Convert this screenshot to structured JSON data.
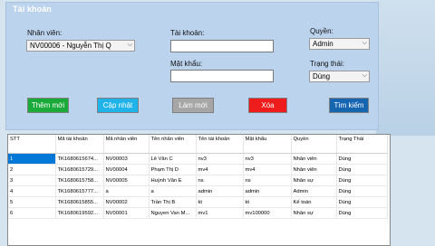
{
  "group_title": "Tài khoản",
  "labels": {
    "employee": "Nhân viên:",
    "account": "Tài khoản:",
    "password": "Mật khẩu:",
    "role": "Quyền:",
    "status": "Trạng thái:"
  },
  "fields": {
    "employee_value": "NV00006 - Nguyễn Thị Q",
    "account_value": "",
    "password_value": "",
    "role_value": "Admin",
    "status_value": "Dùng"
  },
  "buttons": {
    "add": "Thêm mới",
    "update": "Cập nhật",
    "refresh": "Làm mới",
    "delete": "Xóa",
    "search": "Tìm kiếm"
  },
  "colors": {
    "add": "#1aaa3a",
    "update": "#1fb3ea",
    "refresh": "#a6a6a6",
    "delete": "#ef1c1c",
    "search": "#1565b0"
  },
  "table": {
    "headers": [
      "STT",
      "Mã tài khoản",
      "Mã nhân viên",
      "Tên nhân viên",
      "Tên tài khoản",
      "Mật khẩu",
      "Quyền",
      "Trạng Thái"
    ],
    "rows": [
      [
        "1",
        "TK1680615674...",
        "NV00003",
        "Lê Văn C",
        "nv3",
        "nv3",
        "Nhân viên",
        "Dùng"
      ],
      [
        "2",
        "TK1680615729...",
        "NV00004",
        "Phạm Thị D",
        "mv4",
        "mv4",
        "Nhân viên",
        "Dùng"
      ],
      [
        "3",
        "TK1680615758...",
        "NV00005",
        "Huỳnh Văn E",
        "ns",
        "ns",
        "Nhân sự",
        "Dùng"
      ],
      [
        "4",
        "TK1680615777...",
        "a",
        "a",
        "admin",
        "admin",
        "Admin",
        "Dùng"
      ],
      [
        "5",
        "TK1680615855...",
        "NV00002",
        "Trần Thị B",
        "kt",
        "kt",
        "Kế toán",
        "Dùng"
      ],
      [
        "6",
        "TK1680619592...",
        "NV00001",
        "Nguyen Van M...",
        "mv1",
        "mv100000",
        "Nhân sự",
        "Dùng"
      ]
    ]
  }
}
